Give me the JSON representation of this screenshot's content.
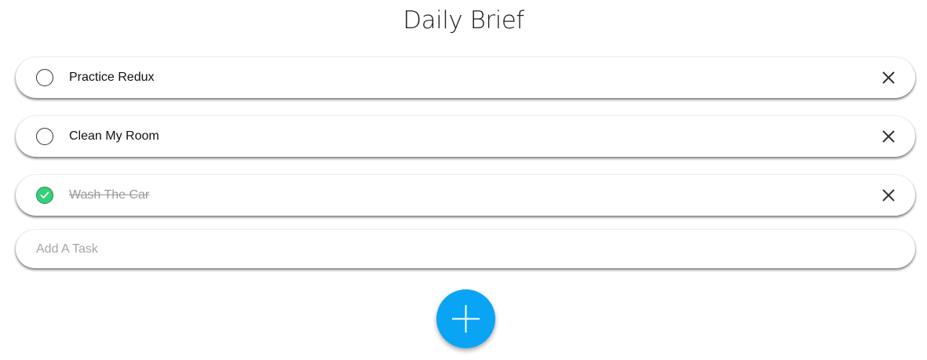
{
  "header": {
    "title": "Daily Brief"
  },
  "tasks": [
    {
      "label": "Practice Redux",
      "completed": false
    },
    {
      "label": "Clean My Room",
      "completed": false
    },
    {
      "label": "Wash The Car",
      "completed": true
    }
  ],
  "add_task": {
    "placeholder": "Add A Task",
    "value": ""
  },
  "icons": {
    "checkbox": "circle-checkbox-icon",
    "checked": "check-icon",
    "delete": "close-icon",
    "add": "plus-icon"
  },
  "colors": {
    "accent": "#0aa4f4",
    "complete": "#33d17a",
    "completed_text": "#999999"
  }
}
